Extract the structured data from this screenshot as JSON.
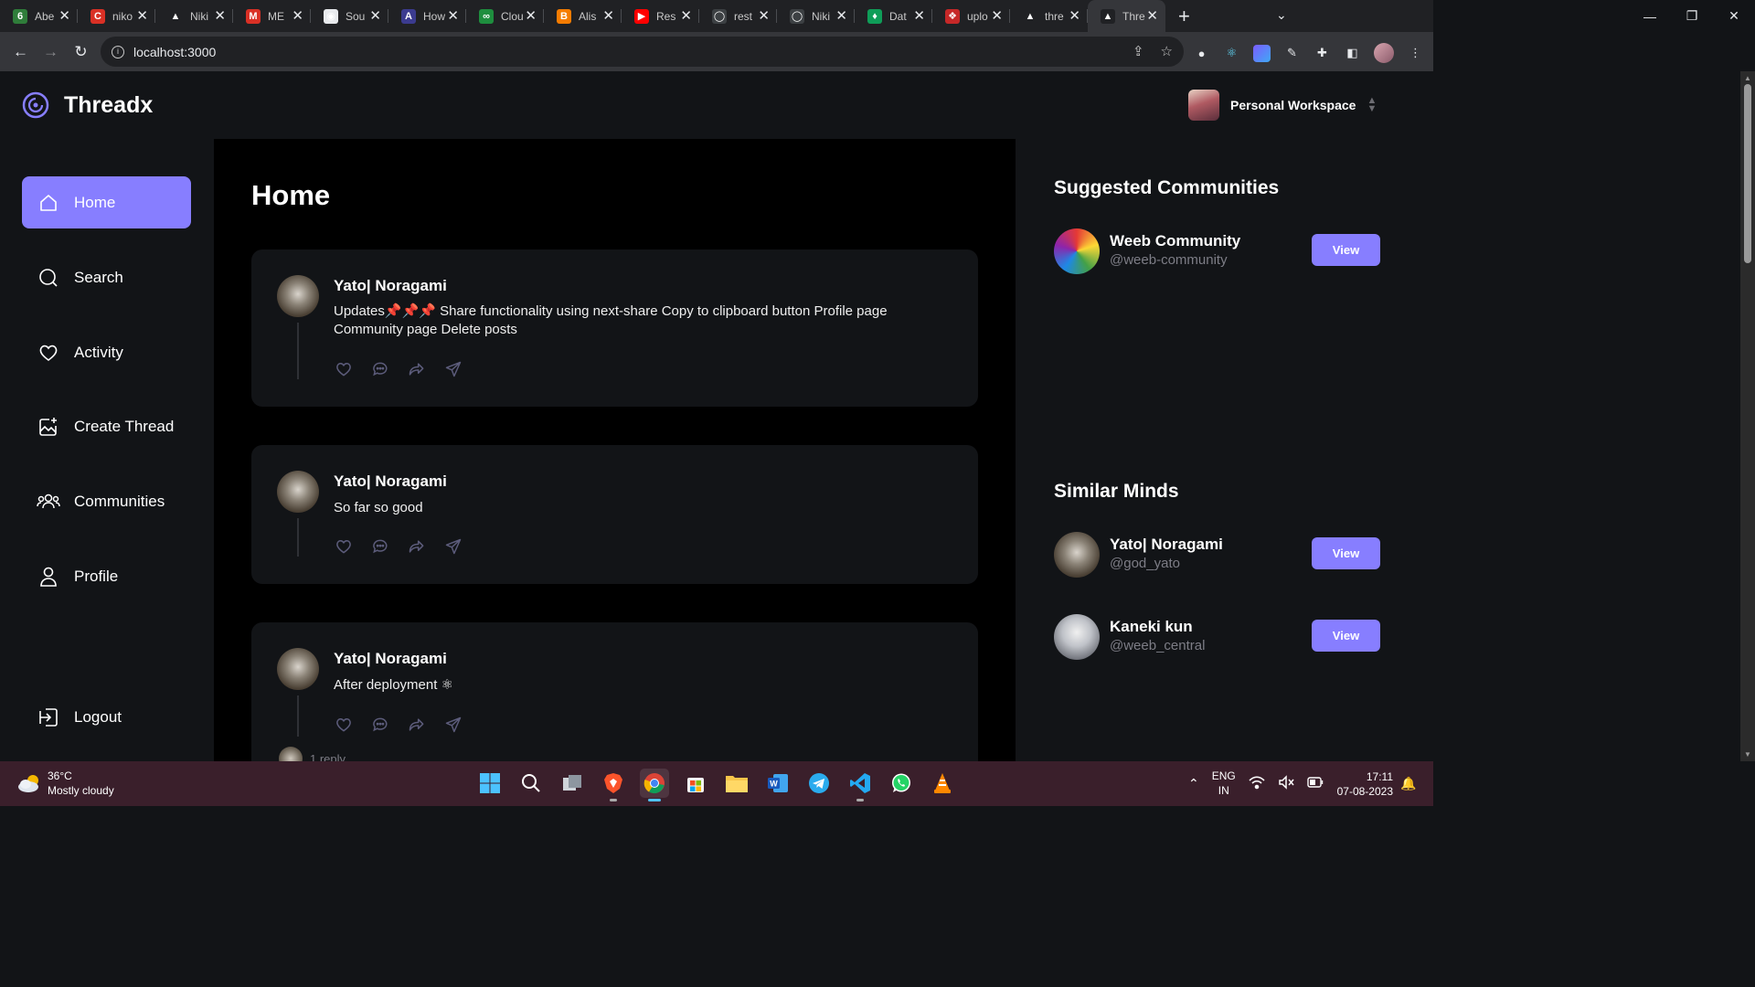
{
  "browser": {
    "tabs": [
      {
        "label": "Abe",
        "color": "#2f7d3a",
        "glyph": "6"
      },
      {
        "label": "niko",
        "color": "#d93025",
        "glyph": "C"
      },
      {
        "label": "Niki",
        "color": "#202124",
        "glyph": "▲"
      },
      {
        "label": "ME",
        "color": "#d93025",
        "glyph": "M"
      },
      {
        "label": "Sou",
        "color": "#e8eaed",
        "glyph": "◉"
      },
      {
        "label": "How",
        "color": "#3b3b8f",
        "glyph": "A"
      },
      {
        "label": "Clou",
        "color": "#1e8e3e",
        "glyph": "∞"
      },
      {
        "label": "Alis",
        "color": "#f57c00",
        "glyph": "B"
      },
      {
        "label": "Res",
        "color": "#ff0000",
        "glyph": "▶"
      },
      {
        "label": "rest",
        "color": "#3c4043",
        "glyph": "◯"
      },
      {
        "label": "Niki",
        "color": "#3c4043",
        "glyph": "◯"
      },
      {
        "label": "Dat",
        "color": "#0f9d58",
        "glyph": "♦"
      },
      {
        "label": "uplo",
        "color": "#c62828",
        "glyph": "❖"
      },
      {
        "label": "thre",
        "color": "#202124",
        "glyph": "▲"
      },
      {
        "label": "Thre",
        "color": "#202124",
        "glyph": "▲",
        "active": true
      }
    ],
    "url": "localhost:3000"
  },
  "app": {
    "brand": "Threadx",
    "accent": "#877eff",
    "workspace": "Personal Workspace"
  },
  "sidebar": {
    "items": [
      {
        "label": "Home",
        "icon": "home-icon",
        "active": true
      },
      {
        "label": "Search",
        "icon": "search-icon"
      },
      {
        "label": "Activity",
        "icon": "heart-icon"
      },
      {
        "label": "Create Thread",
        "icon": "create-image-icon"
      },
      {
        "label": "Communities",
        "icon": "communities-icon"
      },
      {
        "label": "Profile",
        "icon": "user-icon"
      }
    ],
    "logout": "Logout"
  },
  "main": {
    "title": "Home",
    "posts": [
      {
        "author": "Yato| Noragami",
        "text": "Updates📌📌📌 Share functionality using next-share Copy to clipboard button Profile page Community page Delete posts"
      },
      {
        "author": "Yato| Noragami",
        "text": "So far so good"
      },
      {
        "author": "Yato| Noragami",
        "text": "After deployment ⚛",
        "replies": "1 reply"
      }
    ]
  },
  "right": {
    "suggested_title": "Suggested Communities",
    "communities": [
      {
        "name": "Weeb Community",
        "handle": "@weeb-community",
        "button": "View"
      }
    ],
    "similar_title": "Similar Minds",
    "people": [
      {
        "name": "Yato| Noragami",
        "handle": "@god_yato",
        "button": "View"
      },
      {
        "name": "Kaneki kun",
        "handle": "@weeb_central",
        "button": "View"
      }
    ]
  },
  "taskbar": {
    "temp": "36°C",
    "weather": "Mostly cloudy",
    "lang1": "ENG",
    "lang2": "IN",
    "time": "17:11",
    "date": "07-08-2023"
  }
}
